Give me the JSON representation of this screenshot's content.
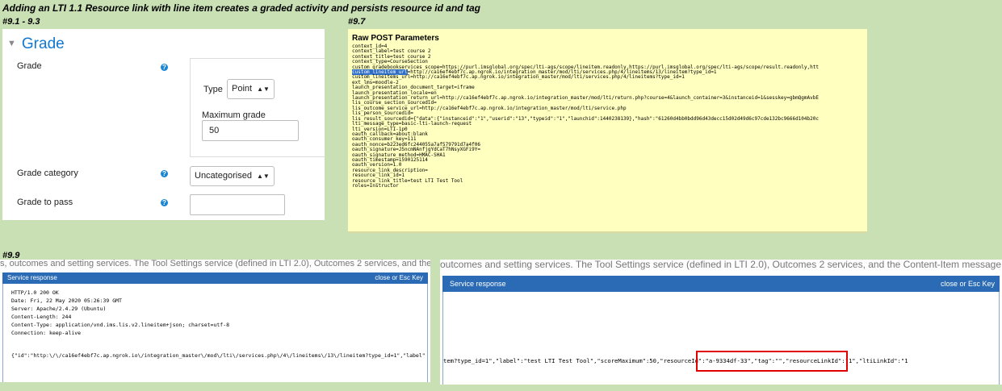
{
  "page": {
    "title": "Adding an LTI 1.1 Resource link with line item creates a graded activity and persists resource id and tag"
  },
  "sections": {
    "s1": "#9.1 - 9.3",
    "s2": "#9.7",
    "s3": "#9.9"
  },
  "grade_form": {
    "heading": "Grade",
    "grade_label": "Grade",
    "type_label": "Type",
    "type_value": "Point",
    "max_grade_label": "Maximum grade",
    "max_grade_value": "50",
    "category_label": "Grade category",
    "category_value": "Uncategorised",
    "pass_label": "Grade to pass",
    "pass_value": ""
  },
  "raw_post": {
    "title": "Raw POST Parameters",
    "lines": [
      "context_id=4",
      "context_label=test course 2",
      "context_title=test course 2",
      "context_type=CourseSection",
      "custom_gradebookservices_scope=https://purl.imsglobal.org/spec/lti-ags/scope/lineitem.readonly,https://purl.imsglobal.org/spec/lti-ags/scope/result.readonly,htt",
      "custom_lineitem_url=http://ca16ef4ebf7c.ap.ngrok.io/integration_master/mod/lti/services.php/4/lineitems/13/lineitem?type_id=1",
      "custom_lineitems_url=http://ca16ef4ebf7c.ap.ngrok.io/integration_master/mod/lti/services.php/4/lineitems?type_id=1",
      "ext_lms=moodle-2",
      "launch_presentation_document_target=iframe",
      "launch_presentation_locale=en",
      "launch_presentation_return_url=http://ca16ef4ebf7c.ap.ngrok.io/integration_master/mod/lti/return.php?course=4&launch_container=3&instanceid=1&sesskey=gbmQgmAvbE",
      "lis_course_section_sourcedid=",
      "lis_outcome_service_url=http://ca16ef4ebf7c.ap.ngrok.io/integration_master/mod/lti/service.php",
      "lis_person_sourcedid=",
      "lis_result_sourcedid={\"data\":{\"instanceid\":\"1\",\"userid\":\"13\",\"typeid\":\"1\",\"launchid\":1440238139},\"hash\":\"61260d4bb0bdd96d43decc15d02d49d6c97cde132bc9666d104b20c",
      "lti_message_type=basic-lti-launch-request",
      "lti_version=LTI-1p0",
      "oauth_callback=about:blank",
      "oauth_consumer_key=111",
      "oauth_nonce=b223ed6fc244055a7af579791d7a4f06",
      "oauth_signature=J5ncmNAnfjgYdCaT7hNsyXGFi9Y=",
      "oauth_signature_method=HMAC-SHA1",
      "oauth_timestamp=1590125114",
      "oauth_version=1.0",
      "resource_link_description=",
      "resource_link_id=1",
      "resource_link_title=test LTI Test Tool",
      "roles=Instructor"
    ],
    "highlight": "custom_lineitem_url"
  },
  "service_left": {
    "bg_text": "s, outcomes and setting services. The Tool Settings service (defined in LTI 2.0), Outcomes 2 services, and the Content-Item message are als",
    "bar_title": "Service response",
    "close_label": "close or Esc Key",
    "lines": [
      "HTTP/1.0 200 OK",
      "Date: Fri, 22 May 2020 05:26:39 GMT",
      "Server: Apache/2.4.29 (Ubuntu)",
      "Content-Length: 244",
      "Content-Type: application/vnd.ims.lis.v2.lineitem+json; charset=utf-8",
      "Connection: keep-alive"
    ],
    "json_line": "{\"id\":\"http:\\/\\/ca16ef4ebf7c.ap.ngrok.io\\/integration_master\\/mod\\/lti\\/services.php\\/4\\/lineitems\\/13\\/lineitem?type_id=1\",\"label\""
  },
  "service_right": {
    "bg_text": "outcomes and setting services. The Tool Settings service (defined in LTI 2.0), Outcomes 2 services, and the Content-Item message are also",
    "bar_title": "Service response",
    "close_label": "close or Esc Key",
    "json_pre": "tem?type_id=1\",\"label\":\"test LTI Test Tool\",\"scoreMaximum\":50,",
    "json_highlight": "\"resourceId\":\"a-9334df-33\",\"tag\":\"\",",
    "json_post": "\"resourceLinkId\":\"1\",\"ltiLinkId\":\"1"
  }
}
